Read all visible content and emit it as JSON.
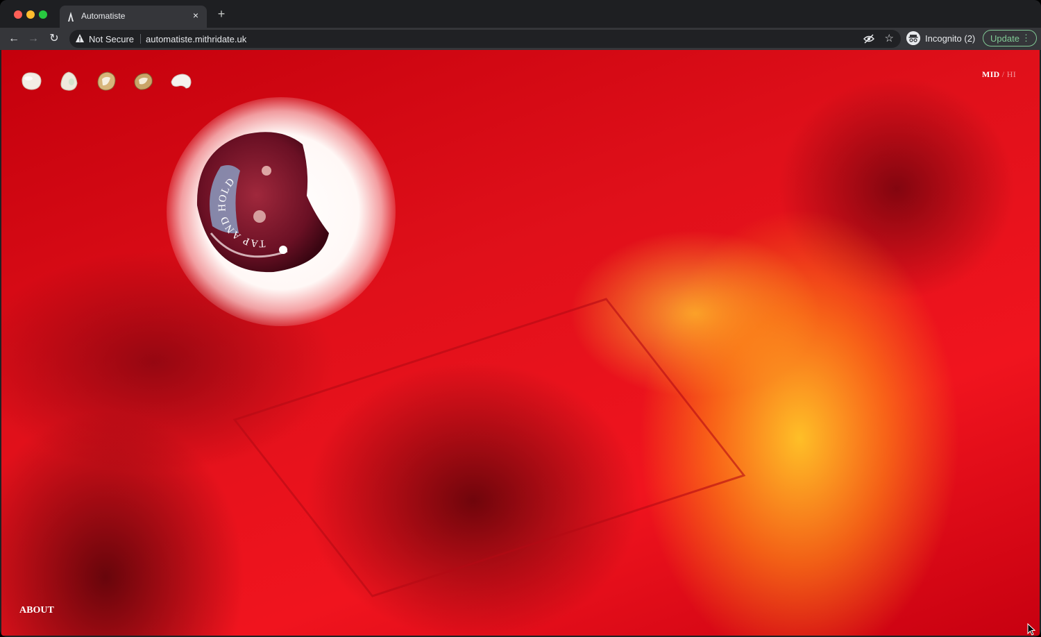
{
  "browser": {
    "tab_title": "Automatiste",
    "tab_close": "×",
    "new_tab": "+",
    "security_label": "Not Secure",
    "url": "automatiste.mithridate.uk",
    "profile_label": "Incognito (2)",
    "update_label": "Update",
    "menu_glyph": "⋮",
    "back_glyph": "←",
    "forward_glyph": "→",
    "reload_glyph": "↻",
    "star_glyph": "☆"
  },
  "page": {
    "stones": [
      {
        "name": "pearl-stone-1",
        "color": "#f3eee6"
      },
      {
        "name": "pearl-stone-2",
        "color": "#efe9dc"
      },
      {
        "name": "gold-stone-3",
        "color": "#d7b57a"
      },
      {
        "name": "gold-stone-4",
        "color": "#c9a468"
      },
      {
        "name": "pearl-stone-5",
        "color": "#f5f2ee"
      }
    ],
    "orb_text": "TAP AND HOLD",
    "resolution": {
      "mid": "MID",
      "separator": " / ",
      "hi": "HI"
    },
    "about_label": "ABOUT"
  },
  "colors": {
    "accent_update": "#81c995",
    "background_red": "#e0101a"
  }
}
